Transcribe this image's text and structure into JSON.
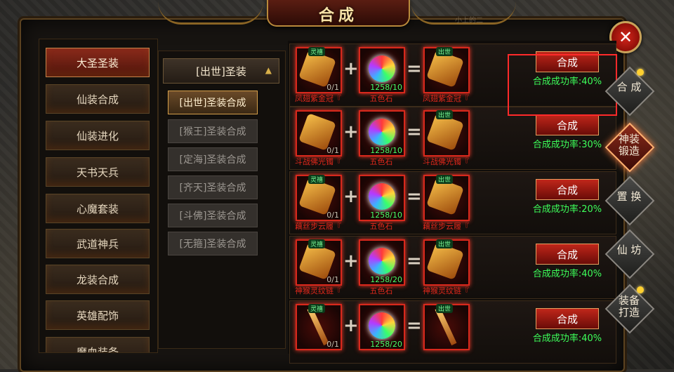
{
  "window": {
    "title": "合成",
    "watermark": "小上的二",
    "close_icon": "close-x-icon"
  },
  "categories": [
    {
      "label": "大圣圣装",
      "active": true
    },
    {
      "label": "仙装合成",
      "active": false
    },
    {
      "label": "仙装进化",
      "active": false
    },
    {
      "label": "天书天兵",
      "active": false
    },
    {
      "label": "心魔套装",
      "active": false
    },
    {
      "label": "武道神兵",
      "active": false
    },
    {
      "label": "龙装合成",
      "active": false
    },
    {
      "label": "英雄配饰",
      "active": false
    },
    {
      "label": "魔血装备",
      "active": false
    }
  ],
  "group": {
    "label": "[出世]圣装",
    "chevron_icon": "chevron-up-icon"
  },
  "subcategories": [
    {
      "label": "[出世]圣装合成",
      "active": true
    },
    {
      "label": "[猴王]圣装合成",
      "active": false
    },
    {
      "label": "[定海]圣装合成",
      "active": false
    },
    {
      "label": "[齐天]圣装合成",
      "active": false
    },
    {
      "label": "[斗佛]圣装合成",
      "active": false
    },
    {
      "label": "[无箍]圣装合成",
      "active": false
    }
  ],
  "recipes": [
    {
      "input_name": "凤翅紫金冠『",
      "input_count": "0/1",
      "material_name": "五色石",
      "material_count": "1258/10",
      "output_name": "凤翅紫金冠『",
      "button": "合成",
      "rate": "合成成功率:40%",
      "input_tag": "灵禧",
      "output_tag": "出世"
    },
    {
      "input_name": "斗战佛光镯『",
      "input_count": "0/1",
      "material_name": "五色石",
      "material_count": "1258/10",
      "output_name": "斗战佛光镯『",
      "button": "合成",
      "rate": "合成成功率:30%",
      "input_tag": "",
      "output_tag": "出世"
    },
    {
      "input_name": "藕丝步云履『",
      "input_count": "0/1",
      "material_name": "五色石",
      "material_count": "1258/10",
      "output_name": "藕丝步云履『",
      "button": "合成",
      "rate": "合成成功率:20%",
      "input_tag": "灵禧",
      "output_tag": "出世"
    },
    {
      "input_name": "神猴灵纹链『",
      "input_count": "0/1",
      "material_name": "五色石",
      "material_count": "1258/20",
      "output_name": "神猴灵纹链『",
      "button": "合成",
      "rate": "合成成功率:40%",
      "input_tag": "灵禧",
      "output_tag": "出世"
    },
    {
      "input_name": "",
      "input_count": "0/1",
      "material_name": "",
      "material_count": "1258/20",
      "output_name": "",
      "button": "合成",
      "rate": "合成成功率:40%",
      "input_tag": "灵禧",
      "output_tag": "出世"
    }
  ],
  "side_tabs": [
    {
      "label": "合 成",
      "active": false,
      "badge": true
    },
    {
      "label": "神装\n锻造",
      "active": true,
      "badge": false
    },
    {
      "label": "置 换",
      "active": false,
      "badge": false
    },
    {
      "label": "仙 坊",
      "active": false,
      "badge": false
    },
    {
      "label": "装备\n打造",
      "active": false,
      "badge": true
    }
  ],
  "colors": {
    "accent_red": "#c0261a",
    "rate_green": "#3dff5a",
    "highlight": "#ff2a2a",
    "gold": "#b98a3b"
  }
}
